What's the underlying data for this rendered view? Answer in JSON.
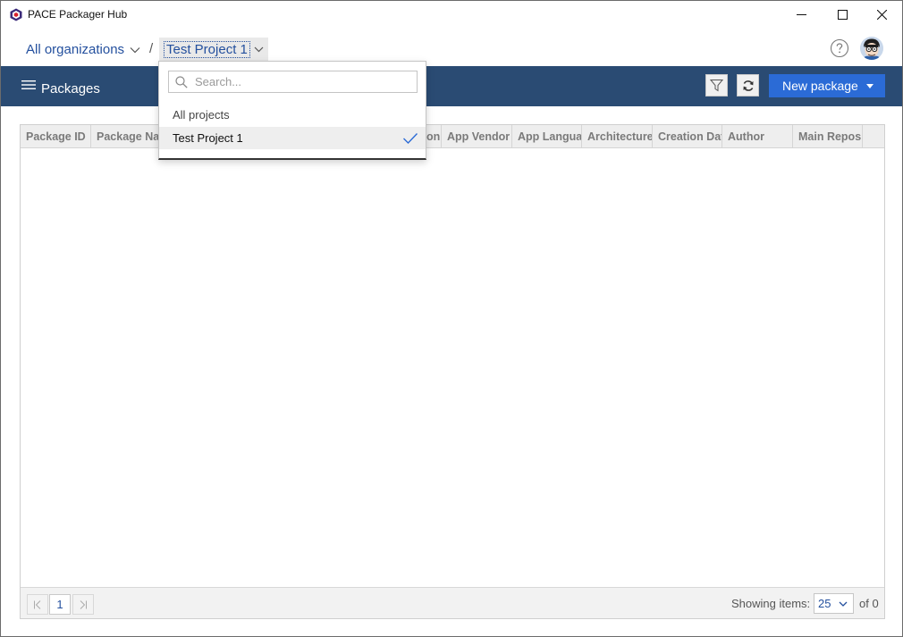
{
  "window": {
    "title": "PACE Packager Hub"
  },
  "breadcrumb": {
    "organization": "All organizations",
    "separator": "/",
    "project": "Test Project 1"
  },
  "toolbar": {
    "title": "Packages",
    "new_package_label": "New package"
  },
  "grid": {
    "columns": [
      "Package ID",
      "Package Nam",
      "on",
      "App Vendor",
      "App Langua",
      "Architecture",
      "Creation Dat",
      "Author",
      "Main Reposi"
    ],
    "rows": []
  },
  "footer": {
    "current_page": "1",
    "showing_label": "Showing items:",
    "page_size": "25",
    "of_total": "of 0"
  },
  "project_dropdown": {
    "search_placeholder": "Search...",
    "items": [
      "All projects",
      "Test Project 1"
    ],
    "selected": "Test Project 1"
  },
  "colors": {
    "toolbar_bg": "#2a4b73",
    "accent_button": "#2b6bd6",
    "link": "#24509e"
  }
}
